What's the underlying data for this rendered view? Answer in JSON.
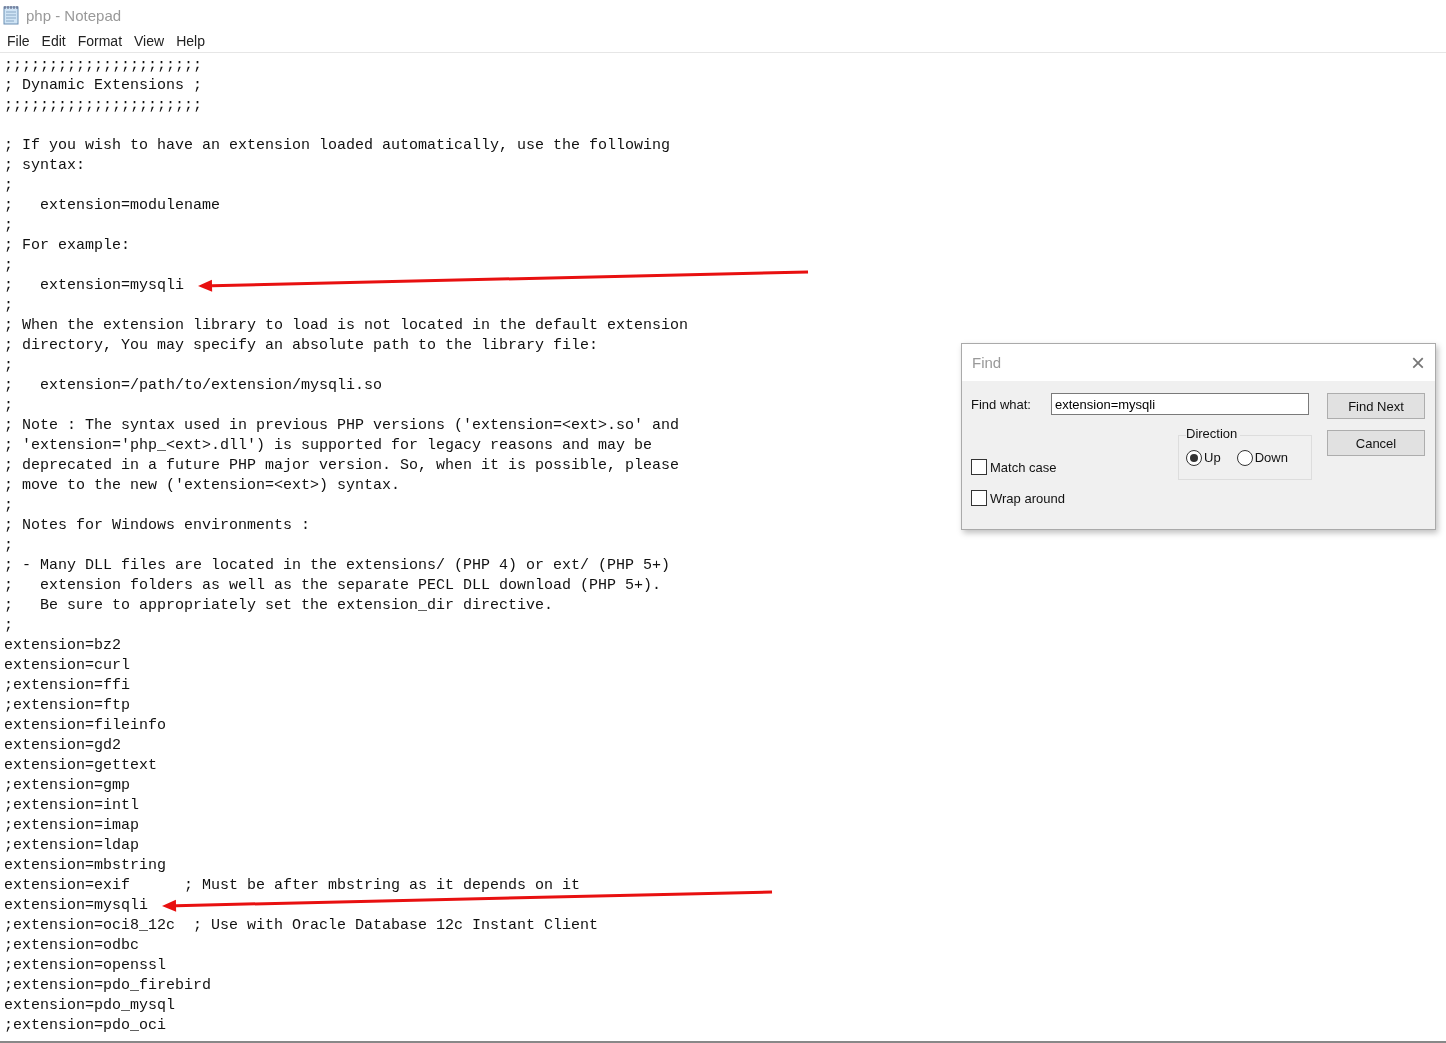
{
  "window": {
    "title": "php - Notepad"
  },
  "menu": [
    "File",
    "Edit",
    "Format",
    "View",
    "Help"
  ],
  "lines": [
    {
      "text": ";;;;;;;;;;;;;;;;;;;;;;",
      "arrow": false
    },
    {
      "text": "; Dynamic Extensions ;",
      "arrow": false
    },
    {
      "text": ";;;;;;;;;;;;;;;;;;;;;;",
      "arrow": false
    },
    {
      "arrow": false
    },
    {
      "text": "; If you wish to have an extension loaded automatically, use the following",
      "arrow": false
    },
    {
      "text": "; syntax:",
      "arrow": false
    },
    {
      "text": ";",
      "arrow": false
    },
    {
      "text": ";   extension=modulename",
      "arrow": false
    },
    {
      "text": ";",
      "arrow": false
    },
    {
      "text": "; For example:",
      "arrow": false
    },
    {
      "text": ";",
      "arrow": false
    },
    {
      "text": ";   extension=mysqli",
      "arrow": true
    },
    {
      "text": ";",
      "arrow": false
    },
    {
      "text": "; When the extension library to load is not located in the default extension",
      "arrow": false
    },
    {
      "text": "; directory, You may specify an absolute path to the library file:",
      "arrow": false
    },
    {
      "text": ";",
      "arrow": false
    },
    {
      "text": ";   extension=/path/to/extension/mysqli.so",
      "arrow": false
    },
    {
      "text": ";",
      "arrow": false
    },
    {
      "text": "; Note : The syntax used in previous PHP versions ('extension=<ext>.so' and",
      "arrow": false
    },
    {
      "text": "; 'extension='php_<ext>.dll') is supported for legacy reasons and may be",
      "arrow": false
    },
    {
      "text": "; deprecated in a future PHP major version. So, when it is possible, please",
      "arrow": false
    },
    {
      "text": "; move to the new ('extension=<ext>) syntax.",
      "arrow": false
    },
    {
      "text": ";",
      "arrow": false
    },
    {
      "text": "; Notes for Windows environments :",
      "arrow": false
    },
    {
      "text": ";",
      "arrow": false
    },
    {
      "text": "; - Many DLL files are located in the extensions/ (PHP 4) or ext/ (PHP 5+)",
      "arrow": false
    },
    {
      "text": ";   extension folders as well as the separate PECL DLL download (PHP 5+).",
      "arrow": false
    },
    {
      "text": ";   Be sure to appropriately set the extension_dir directive.",
      "arrow": false
    },
    {
      "text": ";",
      "arrow": false
    },
    {
      "text": "extension=bz2",
      "arrow": false
    },
    {
      "text": "extension=curl",
      "arrow": false
    },
    {
      "text": ";extension=ffi",
      "arrow": false
    },
    {
      "text": ";extension=ftp",
      "arrow": false
    },
    {
      "text": "extension=fileinfo",
      "arrow": false
    },
    {
      "text": "extension=gd2",
      "arrow": false
    },
    {
      "text": "extension=gettext",
      "arrow": false
    },
    {
      "text": ";extension=gmp",
      "arrow": false
    },
    {
      "text": ";extension=intl",
      "arrow": false
    },
    {
      "text": ";extension=imap",
      "arrow": false
    },
    {
      "text": ";extension=ldap",
      "arrow": false
    },
    {
      "text": "extension=mbstring",
      "arrow": false
    },
    {
      "text": "extension=exif      ; Must be after mbstring as it depends on it",
      "arrow": false
    },
    {
      "text": "extension=mysqli",
      "arrow": true
    },
    {
      "text": ";extension=oci8_12c  ; Use with Oracle Database 12c Instant Client",
      "arrow": false
    },
    {
      "text": ";extension=odbc",
      "arrow": false
    },
    {
      "text": ";extension=openssl",
      "arrow": false
    },
    {
      "text": ";extension=pdo_firebird",
      "arrow": false
    },
    {
      "text": "extension=pdo_mysql",
      "arrow": false
    },
    {
      "text": ";extension=pdo_oci",
      "arrow": false
    }
  ],
  "find_dialog": {
    "title": "Find",
    "close": "×",
    "find_what_label": "Find what:",
    "find_what_value": "extension=mysqli",
    "buttons": [
      "Find Next",
      "Cancel"
    ],
    "direction_label": "Direction",
    "direction": [
      {
        "label": "Up",
        "selected": true
      },
      {
        "label": "Down",
        "selected": false
      }
    ],
    "options": [
      {
        "label": "Match case",
        "checked": false
      },
      {
        "label": "Wrap around",
        "checked": false
      }
    ]
  }
}
